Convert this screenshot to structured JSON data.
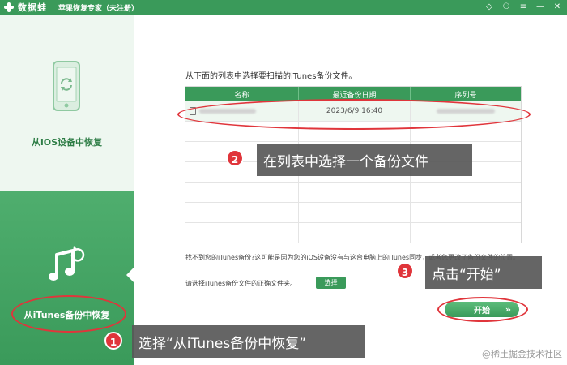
{
  "titlebar": {
    "logo_text": "数据蛙",
    "app_title": "苹果恢复专家（未注册）",
    "controls": [
      {
        "name": "diamond-icon",
        "glyph": "◇"
      },
      {
        "name": "user-icon",
        "glyph": "⚇"
      },
      {
        "name": "menu-icon",
        "glyph": "≡"
      },
      {
        "name": "minimize-icon",
        "glyph": "—"
      },
      {
        "name": "close-icon",
        "glyph": "✕"
      }
    ]
  },
  "sidebar": {
    "ios_label": "从iOS设备中恢复",
    "itunes_label": "从iTunes备份中恢复"
  },
  "main": {
    "instruction": "从下面的列表中选择要扫描的iTunes备份文件。",
    "table": {
      "headers": [
        "名称",
        "最近备份日期",
        "序列号"
      ],
      "rows": [
        {
          "date": "2023/6/9 16:40"
        }
      ]
    },
    "note": "找不到您的iTunes备份?这可能是因为您的iOS设备没有与这台电脑上的iTunes同步，或者您更改了备份文件的位置。",
    "choose_text": "请选择iTunes备份文件的正确文件夹。",
    "choose_button": "选择",
    "start_button": "开始",
    "start_chevron": "»"
  },
  "annotations": {
    "badge1": "1",
    "badge2": "2",
    "badge3": "3",
    "callout1": "选择“从iTunes备份中恢复”",
    "callout2": "在列表中选择一个备份文件",
    "callout3": "点击“开始”"
  },
  "watermark": "@稀土掘金技术社区",
  "colors": {
    "brand_green": "#3a9a5a",
    "annotation_red": "#e0353b",
    "callout_gray": "#585858"
  }
}
